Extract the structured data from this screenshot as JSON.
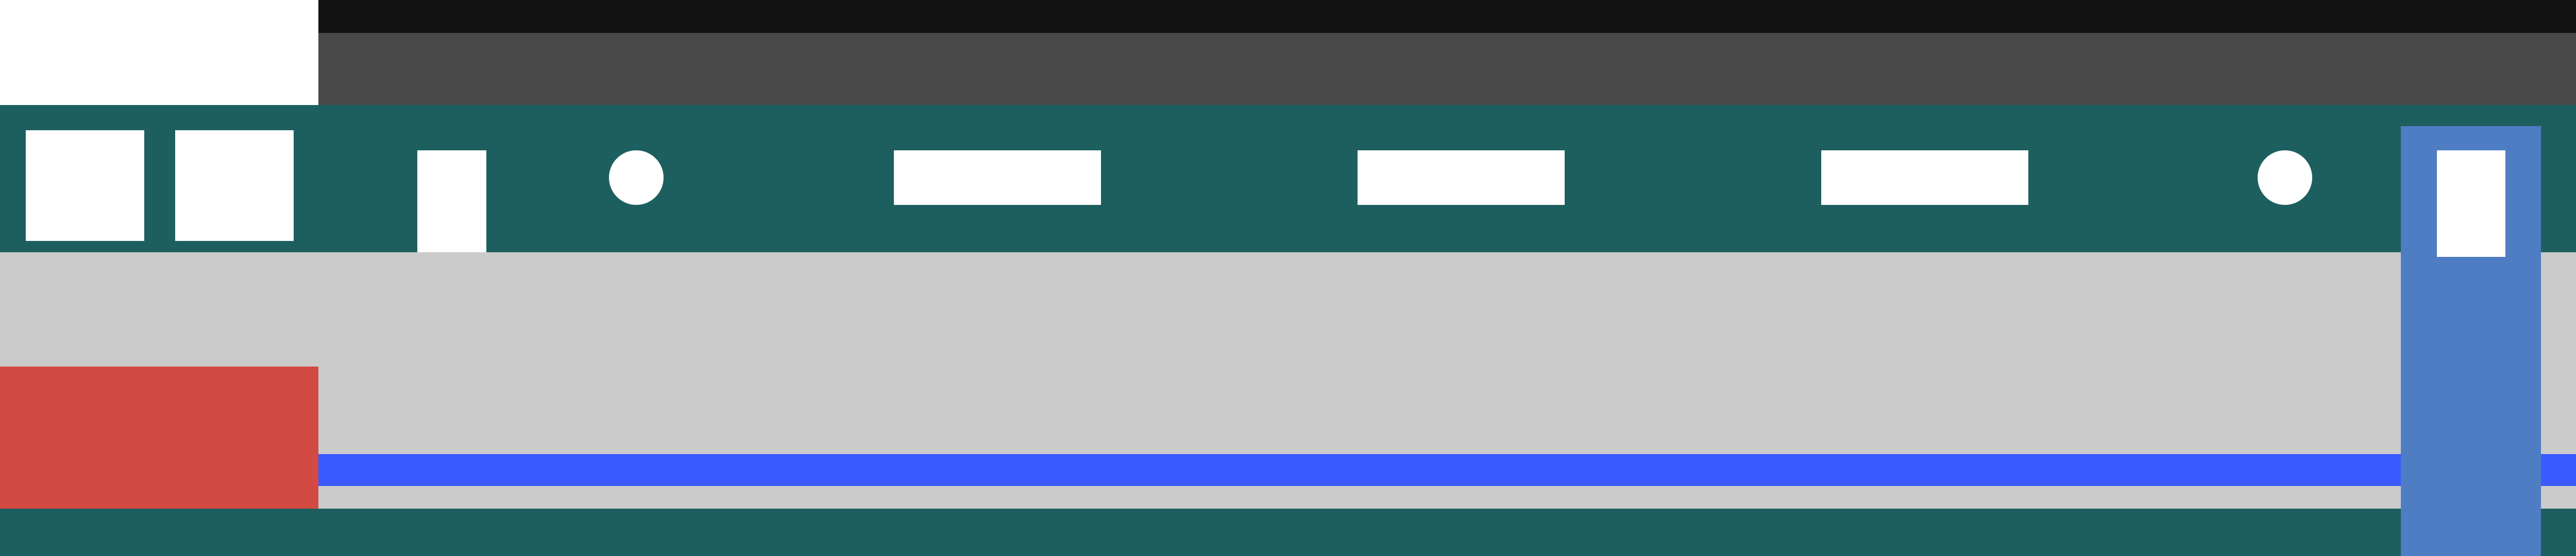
{
  "window": {
    "title": ""
  },
  "toolbar": {
    "buttons": [
      {
        "icon": "square-icon"
      },
      {
        "icon": "square-icon"
      },
      {
        "icon": "document-icon"
      },
      {
        "icon": "dot-icon"
      },
      {
        "icon": "bar-icon"
      },
      {
        "icon": "bar-icon"
      },
      {
        "icon": "bar-icon"
      },
      {
        "icon": "dot-icon"
      },
      {
        "icon": "document-icon"
      }
    ]
  },
  "colors": {
    "title_bar": "#121212",
    "menu_bar": "#484848",
    "toolbar": "#1d5f5f",
    "content": "#cbcbcb",
    "status_block": "#d34a43",
    "progress": "#3b5afe",
    "selection": "#4e7dc4"
  }
}
